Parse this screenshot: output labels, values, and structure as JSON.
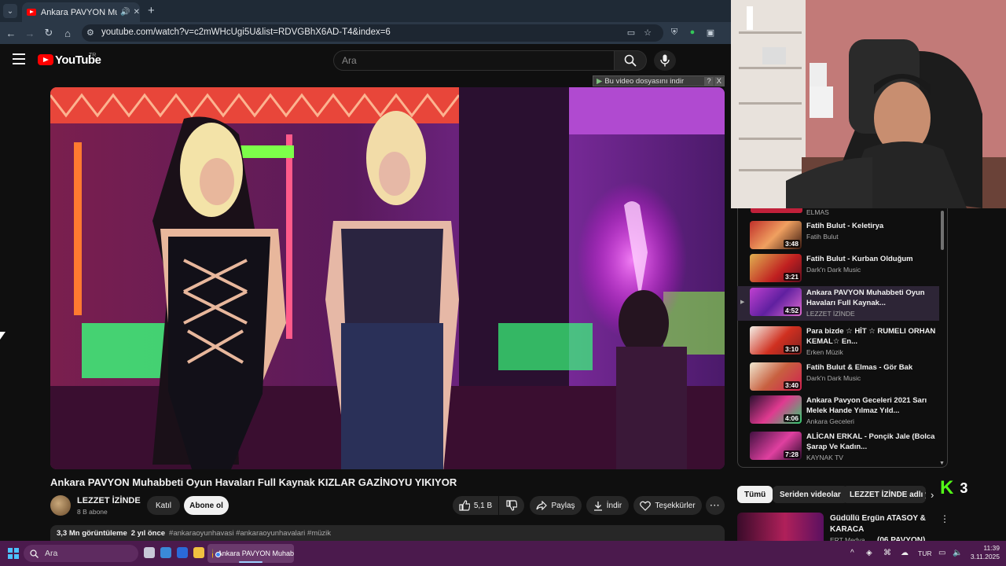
{
  "browser": {
    "tab_title": "Ankara PAVYON Muhabbeti",
    "url": "youtube.com/watch?v=c2mWHcUgi5U&list=RDVGBhX6AD-T4&index=6"
  },
  "youtube": {
    "logo_text": "YouTube",
    "country_code": "TR",
    "search_placeholder": "Ara",
    "download_banner": "Bu video dosyasını indir",
    "download_banner_help": "?",
    "download_banner_close": "X"
  },
  "video": {
    "title": "Ankara PAVYON Muhabbeti Oyun Havaları Full Kaynak KIZLAR GAZİNOYU YIKIYOR",
    "channel_name": "LEZZET İZİNDE",
    "subscribers": "8 B abone",
    "join_label": "Katıl",
    "subscribe_label": "Abone ol",
    "likes": "5,1 B",
    "share_label": "Paylaş",
    "download_label": "İndir",
    "thanks_label": "Teşekkürler",
    "views": "3,3 Mn görüntüleme",
    "age": "2 yıl önce",
    "hashtags": "#ankaraoyunhavasi #ankaraoyunhavalari #müzik"
  },
  "playlist": {
    "top_partial_channel": "ELMAS",
    "items": [
      {
        "title": "Fatih Bulut - Keletirya",
        "channel": "Fatih Bulut",
        "duration": "3:48"
      },
      {
        "title": "Fatih Bulut - Kurban Olduğum",
        "channel": "Dark'n Dark Music",
        "duration": "3:21"
      },
      {
        "title": "Ankara PAVYON Muhabbeti Oyun Havaları Full Kaynak...",
        "channel": "LEZZET İZİNDE",
        "duration": "4:52",
        "active": true
      },
      {
        "title": "Para bizde ☆ HİT ☆ RUMELI ORHAN KEMAL☆ En...",
        "channel": "Erken Müzik",
        "duration": "3:10"
      },
      {
        "title": "Fatih Bulut & Elmas - Gör Bak",
        "channel": "Dark'n Dark Music",
        "duration": "3:40"
      },
      {
        "title": "Ankara Pavyon Geceleri 2021 Sarı Melek Hande Yılmaz Yıld...",
        "channel": "Ankara Geceleri",
        "duration": "4:06"
      },
      {
        "title": "ALİCAN ERKAL - Ponçik Jale (Bolca Şarap Ve Kadın...",
        "channel": "KAYNAK TV",
        "duration": "7:28"
      }
    ]
  },
  "chips": [
    "Tümü",
    "Seriden videolar",
    "LEZZET İZİNDE adlı y"
  ],
  "kick": {
    "logo": "K",
    "count": "3"
  },
  "recommendation": {
    "title_line1": "Güdüllü Ergün ATASOY & KARACA",
    "title_line2": "(06 PAVYON)",
    "channel": "ERT Medya"
  },
  "taskbar": {
    "search_placeholder": "Ara",
    "chrome_item": "Ankara PAVYON Muhab",
    "lang": "TUR",
    "time": "11:39",
    "date": "3.11.2025"
  },
  "colors": {
    "youtube_red": "#ff0000",
    "kick_green": "#53fc18",
    "taskbar_bg": "#4b1a4d",
    "playlist_active_bg": "#2d2536"
  }
}
